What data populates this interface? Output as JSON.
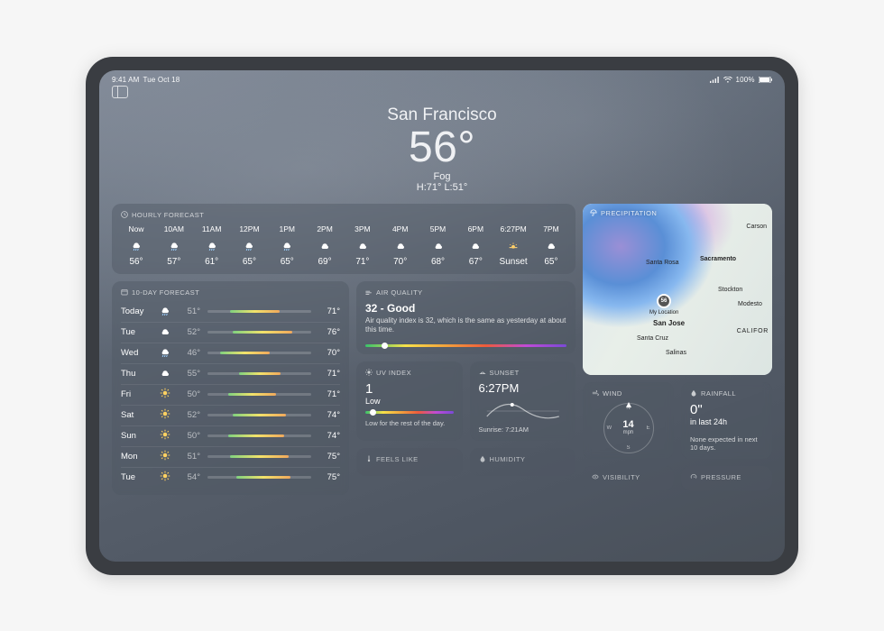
{
  "statusbar": {
    "time": "9:41 AM",
    "date": "Tue Oct 18",
    "battery": "100%"
  },
  "hero": {
    "city": "San Francisco",
    "temp": "56°",
    "condition": "Fog",
    "hilo": "H:71° L:51°"
  },
  "sections": {
    "hourly": "Hourly Forecast",
    "tenday": "10-Day Forecast",
    "aq": "Air Quality",
    "precip": "Precipitation",
    "uv": "UV Index",
    "sunset": "Sunset",
    "wind": "Wind",
    "rainfall": "Rainfall",
    "feels": "Feels Like",
    "humidity": "Humidity",
    "visibility": "Visibility",
    "pressure": "Pressure"
  },
  "hourly": [
    {
      "t": "Now",
      "icon": "cloud-rain",
      "temp": "56°"
    },
    {
      "t": "10AM",
      "icon": "cloud-rain",
      "temp": "57°"
    },
    {
      "t": "11AM",
      "icon": "cloud-rain",
      "temp": "61°"
    },
    {
      "t": "12PM",
      "icon": "cloud-rain",
      "temp": "65°"
    },
    {
      "t": "1PM",
      "icon": "cloud-rain",
      "temp": "65°"
    },
    {
      "t": "2PM",
      "icon": "cloud",
      "temp": "69°"
    },
    {
      "t": "3PM",
      "icon": "cloud",
      "temp": "71°"
    },
    {
      "t": "4PM",
      "icon": "cloud",
      "temp": "70°"
    },
    {
      "t": "5PM",
      "icon": "cloud",
      "temp": "68°"
    },
    {
      "t": "6PM",
      "icon": "cloud",
      "temp": "67°"
    },
    {
      "t": "6:27PM",
      "icon": "sunset",
      "temp": "Sunset"
    },
    {
      "t": "7PM",
      "icon": "cloud",
      "temp": "65°"
    }
  ],
  "tenday": [
    {
      "day": "Today",
      "icon": "cloud-rain",
      "lo": "51°",
      "hi": "71°",
      "barL": 22,
      "barW": 48
    },
    {
      "day": "Tue",
      "icon": "cloud",
      "lo": "52°",
      "hi": "76°",
      "barL": 24,
      "barW": 58
    },
    {
      "day": "Wed",
      "icon": "cloud-rain",
      "lo": "46°",
      "hi": "70°",
      "barL": 12,
      "barW": 48
    },
    {
      "day": "Thu",
      "icon": "cloud",
      "lo": "55°",
      "hi": "71°",
      "barL": 30,
      "barW": 40
    },
    {
      "day": "Fri",
      "icon": "sun",
      "lo": "50°",
      "hi": "71°",
      "barL": 20,
      "barW": 46
    },
    {
      "day": "Sat",
      "icon": "sun",
      "lo": "52°",
      "hi": "74°",
      "barL": 24,
      "barW": 52
    },
    {
      "day": "Sun",
      "icon": "sun",
      "lo": "50°",
      "hi": "74°",
      "barL": 20,
      "barW": 54
    },
    {
      "day": "Mon",
      "icon": "sun",
      "lo": "51°",
      "hi": "75°",
      "barL": 22,
      "barW": 56
    },
    {
      "day": "Tue",
      "icon": "sun",
      "lo": "54°",
      "hi": "75°",
      "barL": 28,
      "barW": 52
    }
  ],
  "aq": {
    "value": "32 - Good",
    "desc": "Air quality index is 32, which is the same as yesterday at about this time.",
    "dotPct": 8
  },
  "uv": {
    "value": "1",
    "label": "Low",
    "foot": "Low for the rest of the day.",
    "dotPct": 5
  },
  "sunset": {
    "time": "6:27PM",
    "sunrise": "Sunrise: 7:21AM"
  },
  "wind": {
    "speed": "14",
    "unit": "mph",
    "n": "N",
    "s": "S",
    "e": "E",
    "w": "W"
  },
  "rainfall": {
    "value": "0\"",
    "period": "in last 24h",
    "foot": "None expected in next 10 days."
  },
  "map": {
    "myloc": "My Location",
    "myloc_temp": "56",
    "cities": {
      "santarosa": "Santa Rosa",
      "sacramento": "Sacramento",
      "stockton": "Stockton",
      "modesto": "Modesto",
      "sanjose": "San Jose",
      "santacruz": "Santa Cruz",
      "salinas": "Salinas",
      "califor": "CALIFOR",
      "carson": "Carson"
    }
  }
}
